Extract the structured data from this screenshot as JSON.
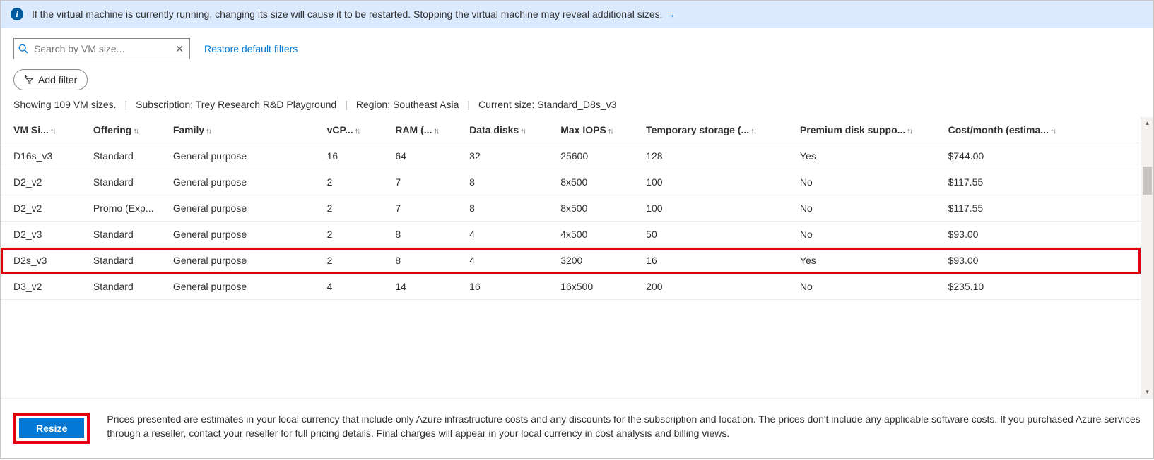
{
  "banner": {
    "text": "If the virtual machine is currently running, changing its size will cause it to be restarted. Stopping the virtual machine may reveal additional sizes.",
    "link_icon": "→"
  },
  "search": {
    "placeholder": "Search by VM size..."
  },
  "restore_link": "Restore default filters",
  "add_filter_label": "Add filter",
  "summary": {
    "count_text": "Showing 109 VM sizes.",
    "subscription_label": "Subscription: Trey Research R&D Playground",
    "region_label": "Region: Southeast Asia",
    "current_label": "Current size: Standard_D8s_v3"
  },
  "columns": [
    "VM Si...",
    "Offering",
    "Family",
    "vCP...",
    "RAM (...",
    "Data disks",
    "Max IOPS",
    "Temporary storage (...",
    "Premium disk suppo...",
    "Cost/month (estima..."
  ],
  "rows": [
    {
      "size": "D16s_v3",
      "offering": "Standard",
      "family": "General purpose",
      "vcpu": "16",
      "ram": "64",
      "disks": "32",
      "iops": "25600",
      "temp": "128",
      "premium": "Yes",
      "cost": "$744.00",
      "highlight": false
    },
    {
      "size": "D2_v2",
      "offering": "Standard",
      "family": "General purpose",
      "vcpu": "2",
      "ram": "7",
      "disks": "8",
      "iops": "8x500",
      "temp": "100",
      "premium": "No",
      "cost": "$117.55",
      "highlight": false
    },
    {
      "size": "D2_v2",
      "offering": "Promo (Exp...",
      "family": "General purpose",
      "vcpu": "2",
      "ram": "7",
      "disks": "8",
      "iops": "8x500",
      "temp": "100",
      "premium": "No",
      "cost": "$117.55",
      "highlight": false
    },
    {
      "size": "D2_v3",
      "offering": "Standard",
      "family": "General purpose",
      "vcpu": "2",
      "ram": "8",
      "disks": "4",
      "iops": "4x500",
      "temp": "50",
      "premium": "No",
      "cost": "$93.00",
      "highlight": false
    },
    {
      "size": "D2s_v3",
      "offering": "Standard",
      "family": "General purpose",
      "vcpu": "2",
      "ram": "8",
      "disks": "4",
      "iops": "3200",
      "temp": "16",
      "premium": "Yes",
      "cost": "$93.00",
      "highlight": true
    },
    {
      "size": "D3_v2",
      "offering": "Standard",
      "family": "General purpose",
      "vcpu": "4",
      "ram": "14",
      "disks": "16",
      "iops": "16x500",
      "temp": "200",
      "premium": "No",
      "cost": "$235.10",
      "highlight": false
    }
  ],
  "footer": {
    "button_label": "Resize",
    "disclaimer": "Prices presented are estimates in your local currency that include only Azure infrastructure costs and any discounts for the subscription and location. The prices don't include any applicable software costs. If you purchased Azure services through a reseller, contact your reseller for full pricing details. Final charges will appear in your local currency in cost analysis and billing views."
  }
}
